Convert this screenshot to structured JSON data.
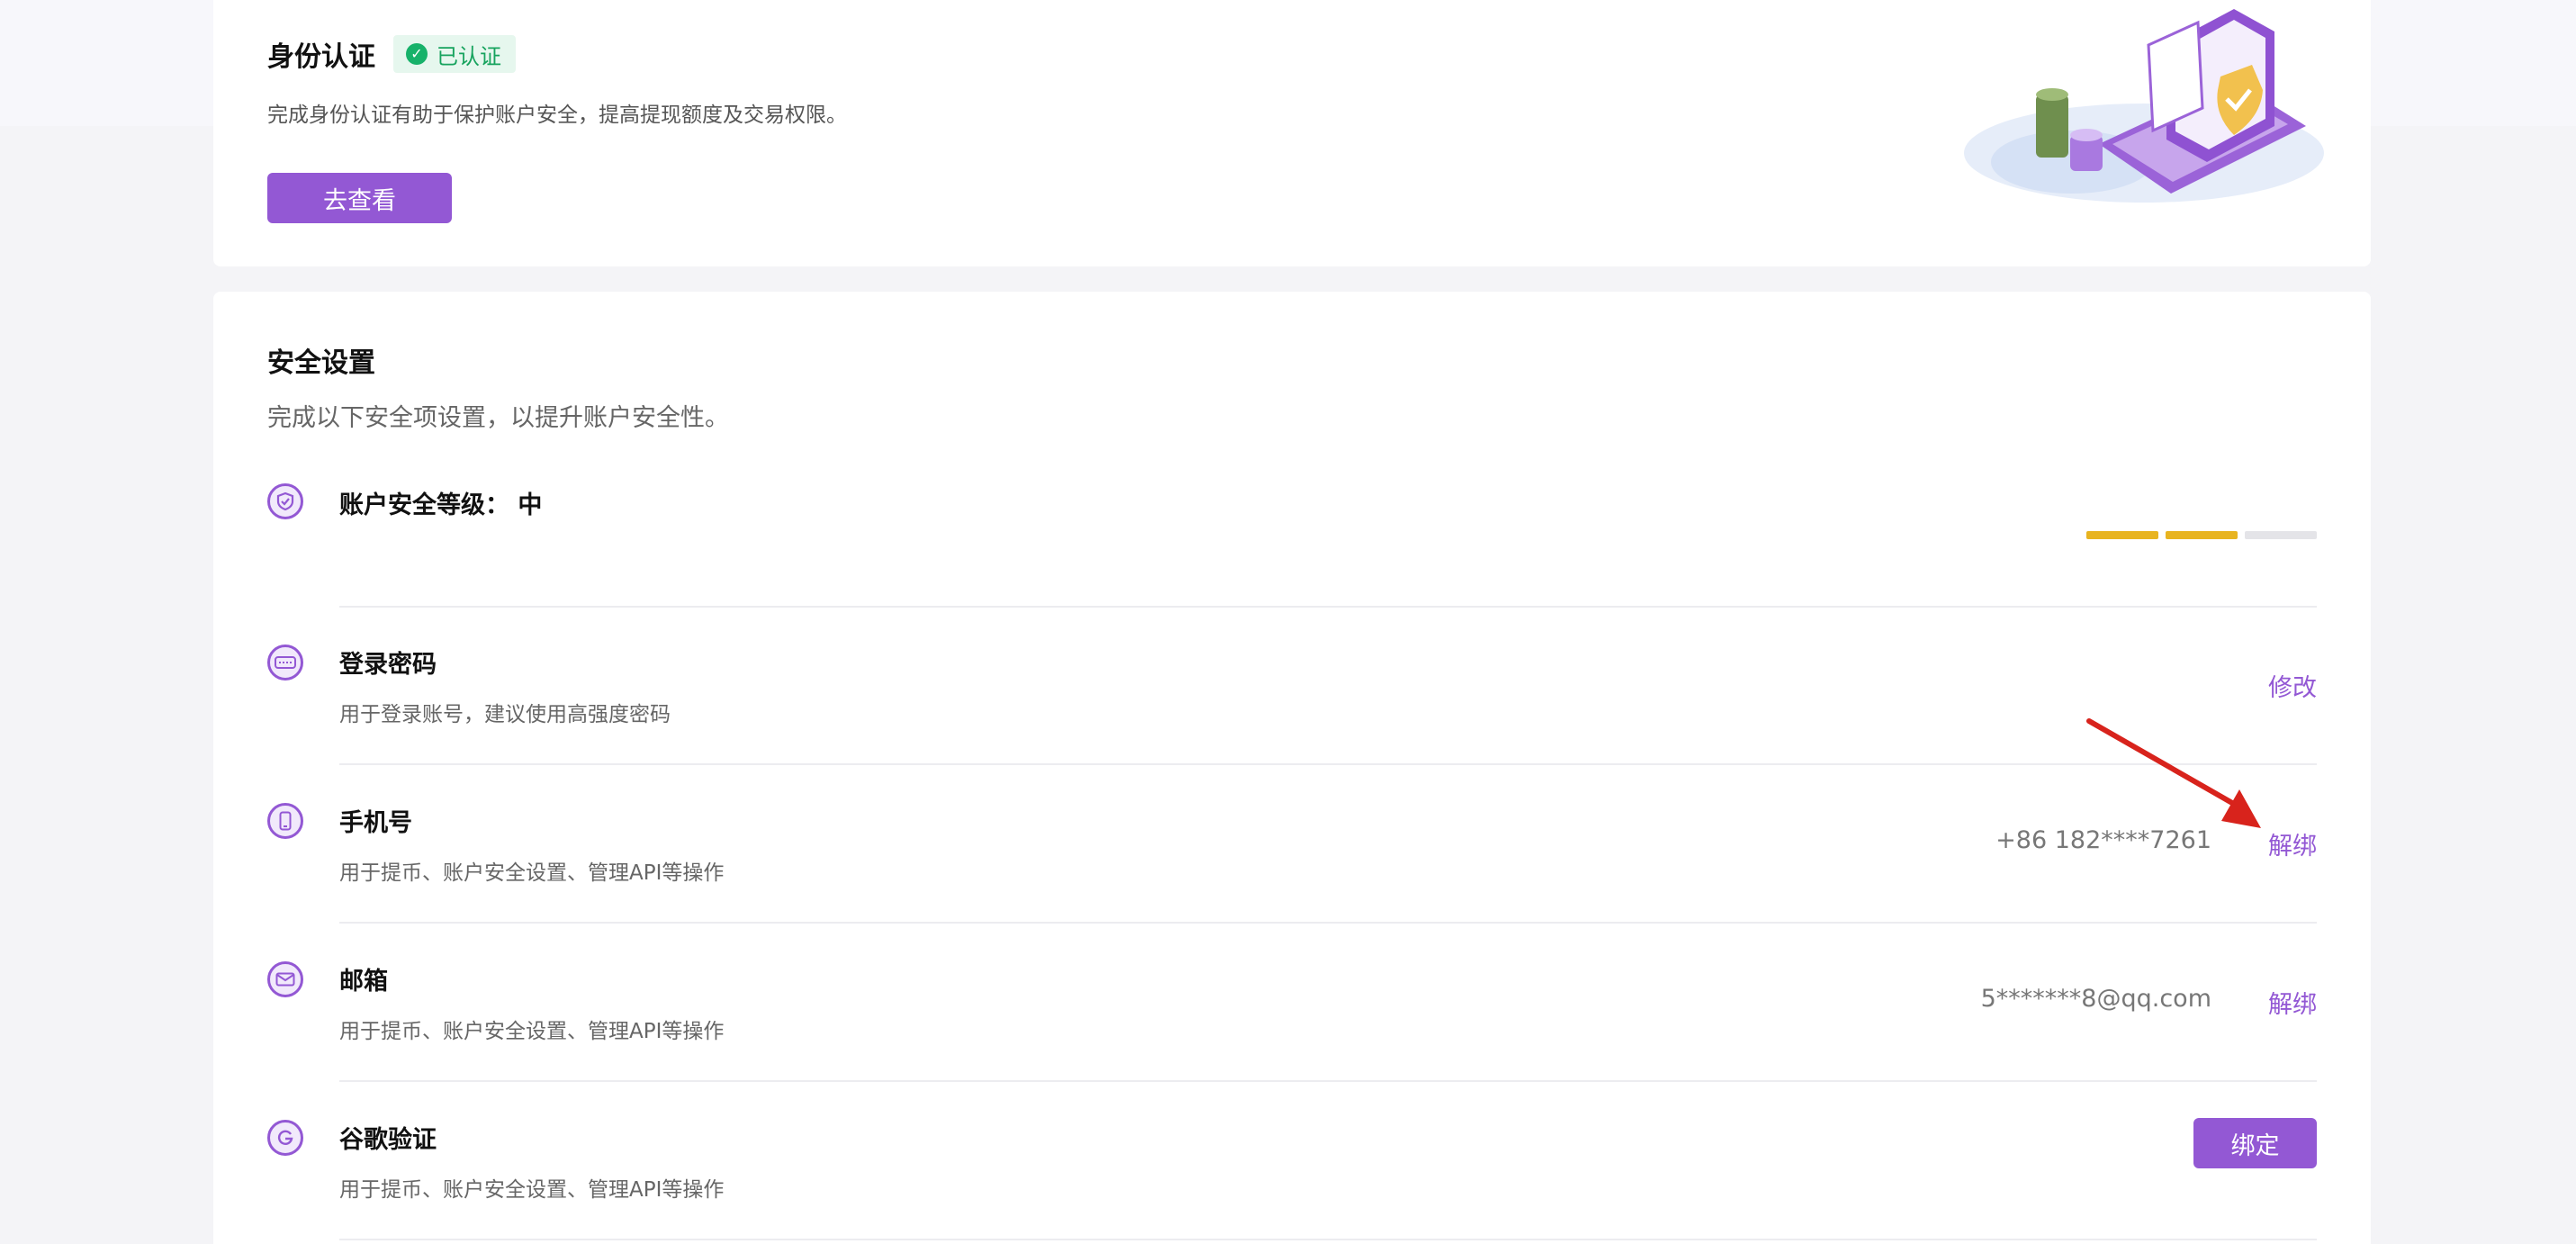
{
  "identity": {
    "title": "身份认证",
    "badge": "已认证",
    "description": "完成身份认证有助于保护账户安全，提高提现额度及交易权限。",
    "button_label": "去查看"
  },
  "security": {
    "title": "安全设置",
    "subtitle": "完成以下安全项设置，以提升账户安全性。",
    "level": {
      "label": "账户安全等级：",
      "value": "中",
      "filled_segments": 2,
      "total_segments": 3
    },
    "items": [
      {
        "label": "登录密码",
        "description": "用于登录账号，建议使用高强度密码",
        "value": "",
        "action": "修改",
        "icon": "keyboard-icon"
      },
      {
        "label": "手机号",
        "description": "用于提币、账户安全设置、管理API等操作",
        "value": "+86 182****7261",
        "action": "解绑",
        "icon": "phone-icon"
      },
      {
        "label": "邮箱",
        "description": "用于提币、账户安全设置、管理API等操作",
        "value": "5*******8@qq.com",
        "action": "解绑",
        "icon": "mail-icon"
      },
      {
        "label": "谷歌验证",
        "description": "用于提币、账户安全设置、管理API等操作",
        "value": "",
        "action": "绑定",
        "icon": "google-icon"
      }
    ]
  },
  "colors": {
    "accent": "#9358d4",
    "success": "#17b26a",
    "level_filled": "#e8b420",
    "level_empty": "#e4e4e8",
    "annotation_arrow": "#d8231c"
  }
}
